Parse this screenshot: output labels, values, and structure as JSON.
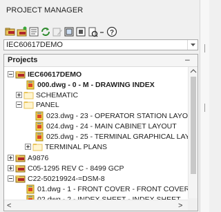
{
  "window": {
    "title": "PROJECT MANAGER"
  },
  "toolbar": {
    "buttons": [
      {
        "icon": "open-project-icon"
      },
      {
        "icon": "new-project-icon"
      },
      {
        "icon": "properties-icon"
      },
      {
        "icon": "refresh-icon"
      },
      {
        "icon": "edit-icon"
      },
      {
        "icon": "add-icon"
      },
      {
        "icon": "remove-icon"
      },
      {
        "icon": "publish-icon"
      },
      {
        "icon": "dropdown-arrow-icon"
      },
      {
        "icon": "help-icon"
      }
    ]
  },
  "project_selector": {
    "value": "IEC60617DEMO"
  },
  "tree": {
    "header": "Projects",
    "collapse_glyph": "–",
    "rows": [
      {
        "label": "IEC60617DEMO",
        "expander": "minus",
        "icon": "project-icon",
        "bold": true
      },
      {
        "label": "000.dwg - 0 - M - DRAWING INDEX",
        "expander": "none",
        "icon": "drawing-icon",
        "bold": true
      },
      {
        "label": "SCHEMATIC",
        "expander": "plus",
        "icon": "folder-icon",
        "bold": false
      },
      {
        "label": "PANEL",
        "expander": "minus",
        "icon": "folder-icon",
        "bold": false
      },
      {
        "label": "023.dwg - 23 - OPERATOR STATION LAYOUT",
        "expander": "none",
        "icon": "drawing-icon",
        "bold": false
      },
      {
        "label": "024.dwg - 24 - MAIN CABINET LAYOUT",
        "expander": "none",
        "icon": "drawing-icon",
        "bold": false
      },
      {
        "label": "025.dwg - 25 - TERMINAL GRAPHICAL LAYOU",
        "expander": "none",
        "icon": "drawing-icon",
        "bold": false
      },
      {
        "label": "TERMINAL PLANS",
        "expander": "plus",
        "icon": "folder-icon",
        "bold": false
      },
      {
        "label": "A9876",
        "expander": "plus",
        "icon": "project-icon",
        "bold": false
      },
      {
        "label": "C05-1295 REV C - 8499 GCP",
        "expander": "plus",
        "icon": "project-icon",
        "bold": false
      },
      {
        "label": "C22-50219924-=DSM-8",
        "expander": "minus",
        "icon": "project-icon",
        "bold": false
      },
      {
        "label": "01.dwg - 1 - FRONT COVER - FRONT COVER",
        "expander": "none",
        "icon": "drawing-icon",
        "bold": false
      },
      {
        "label": "02.dwg - 2 - INDEX SHEET - INDEX SHEET",
        "expander": "none",
        "icon": "drawing-icon",
        "bold": false
      }
    ]
  },
  "scrollbar": {
    "left_arrow": "<",
    "right_arrow": ">"
  },
  "colors": {
    "folder": "#e8c35a",
    "project": "#b0252a",
    "drawing": "#f2d24a"
  }
}
